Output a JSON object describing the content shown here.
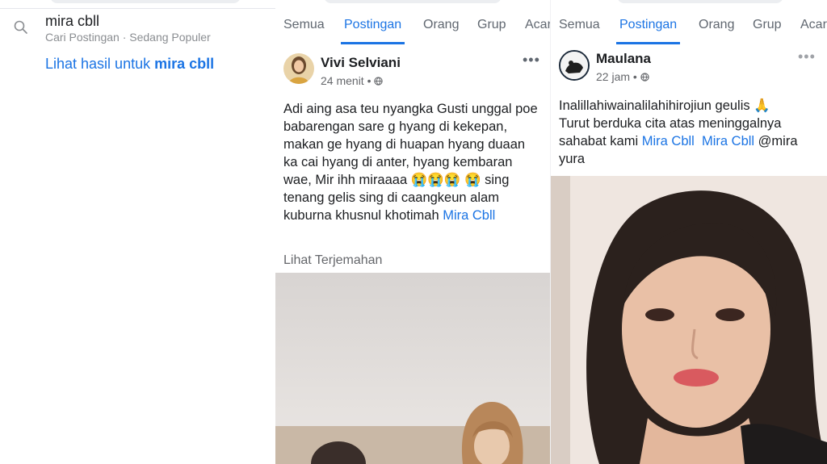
{
  "search": {
    "query": "mira cbll",
    "subtitle": "Cari Postingan · Sedang Populer",
    "see_results_prefix": "Lihat hasil untuk ",
    "see_results_query": "mira cbll"
  },
  "tabs": [
    "Semua",
    "Postingan",
    "Orang",
    "Grup",
    "Acar"
  ],
  "active_tab": "Postingan",
  "post1": {
    "author": "Vivi Selviani",
    "time": "24 menit",
    "body": "Adi aing asa teu nyangka Gusti unggal poe babarengan sare g hyang di kekepan, makan ge hyang di huapan hyang duaan ka cai hyang di anter, hyang kembaran wae, Mir ihh miraaaa",
    "body_emoji": "😭😭😭",
    "body_emoji2": "😭",
    "body_end": " sing tenang gelis sing di caangkeun alam kuburna khusnul khotimah ",
    "mention": "Mira Cbll",
    "see_translation": "Lihat Terjemahan",
    "more": "•••"
  },
  "post2": {
    "author": "Maulana",
    "time": "22 jam",
    "body1": "Inalillahiwainalilahihirojiun geulis ",
    "body1_emoji": "🙏",
    "body2": "Turut berduka cita atas meninggalnya sahabat kami ",
    "mention1": "Mira Cbll",
    "mention2": "Mira Cbll",
    "body_end": " @mira yura",
    "more": "•••"
  },
  "colors": {
    "accent": "#1b74e4",
    "text": "#1c1e21",
    "muted": "#65676b"
  },
  "icons": {
    "search": "search-icon",
    "globe": "globe-icon",
    "more": "more-options-icon"
  }
}
